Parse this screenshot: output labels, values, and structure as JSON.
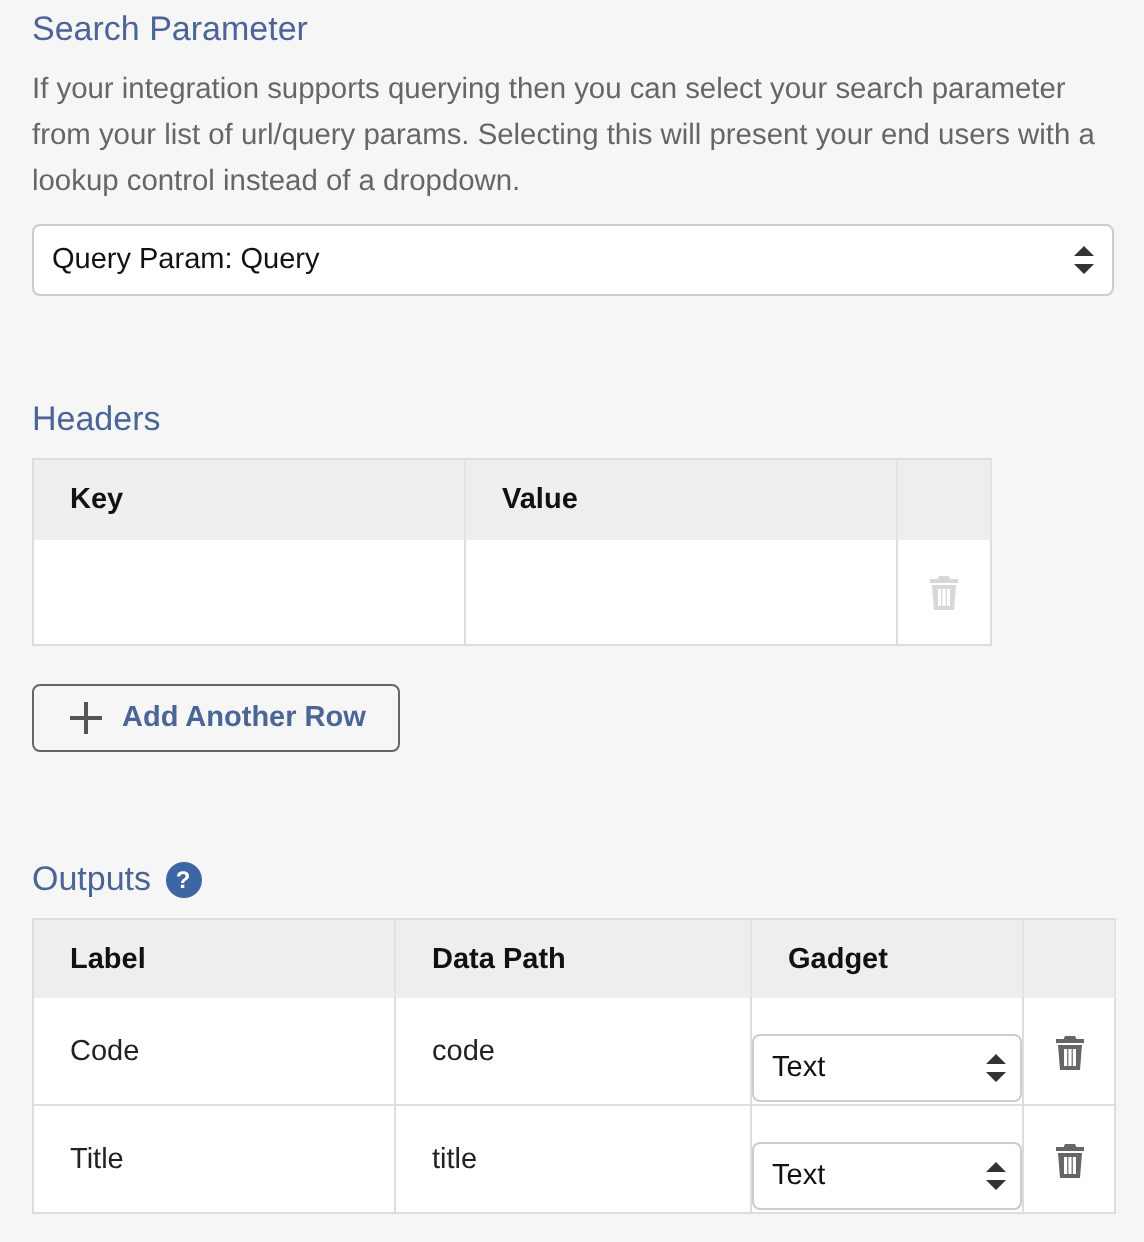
{
  "search_parameter": {
    "title": "Search Parameter",
    "description": "If your integration supports querying then you can select your search parameter from your list of url/query params. Selecting this will present your end users with a lookup control instead of a dropdown.",
    "select": {
      "value": "Query Param: Query"
    }
  },
  "headers": {
    "title": "Headers",
    "columns": [
      "Key",
      "Value"
    ],
    "rows": [
      {
        "key": "",
        "value": "",
        "delete_disabled": true
      }
    ],
    "add_button": "Add Another Row"
  },
  "outputs": {
    "title": "Outputs",
    "help_icon": "?",
    "columns": [
      "Label",
      "Data Path",
      "Gadget"
    ],
    "rows": [
      {
        "label": "Code",
        "data_path": "code",
        "gadget": "Text",
        "delete_disabled": false
      },
      {
        "label": "Title",
        "data_path": "title",
        "gadget": "Text",
        "delete_disabled": false
      }
    ]
  }
}
